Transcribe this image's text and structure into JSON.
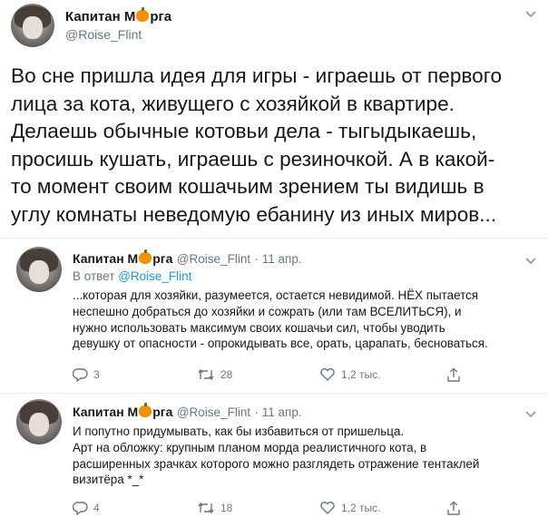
{
  "main_tweet": {
    "display_name_before": "Капитан М",
    "display_name_after": "рга",
    "handle": "@Roise_Flint",
    "text": "Во сне пришла идея для игры - играешь от первого\nлица за кота, живущего с хозяйкой в квартире.\nДелаешь обычные котовьи дела - тыгыдыкаешь,\nпросишь кушать, играешь с резиночкой. А в какой-\nто момент своим кошачьим зрением ты видишь в\nуглу комнаты неведомую ебанину из иных миров..."
  },
  "replies": [
    {
      "display_name_before": "Капитан М",
      "display_name_after": "рга",
      "handle": "@Roise_Flint",
      "date": "· 11 апр.",
      "reply_to_prefix": "В ответ",
      "reply_to_handle": "@Roise_Flint",
      "text": "...которая для хозяйки, разумеется, остается невидимой. НЁХ пытается\nнеспешно добраться до хозяйки и сожрать (или там ВСЕЛИТЬСЯ), и\nнужно использовать максимум своих кошачьи сил, чтобы уводить\nдевушку от опасности - опрокидывать все, орать, царапать, бесноваться.",
      "replies_count": "3",
      "retweets_count": "28",
      "likes_count": "1,2 тыс."
    },
    {
      "display_name_before": "Капитан М",
      "display_name_after": "рга",
      "handle": "@Roise_Flint",
      "date": "· 11 апр.",
      "text": "И попутно придумывать, как бы избавиться от пришельца.\nАрт на обложку: крупным планом морда реалистичного кота, в\nрасширенных зрачках которого можно разглядеть отражение тентаклей\nвизитёра *_*",
      "replies_count": "4",
      "retweets_count": "18",
      "likes_count": "1,2 тыс."
    }
  ],
  "icons": {
    "reply": "reply-icon",
    "retweet": "retweet-icon",
    "like": "heart-icon",
    "share": "share-icon",
    "more": "chevron-down-icon",
    "emoji": "pumpkin-icon"
  },
  "colors": {
    "link": "#1b95e0",
    "secondary": "#657786",
    "pumpkin": "#f39200"
  }
}
